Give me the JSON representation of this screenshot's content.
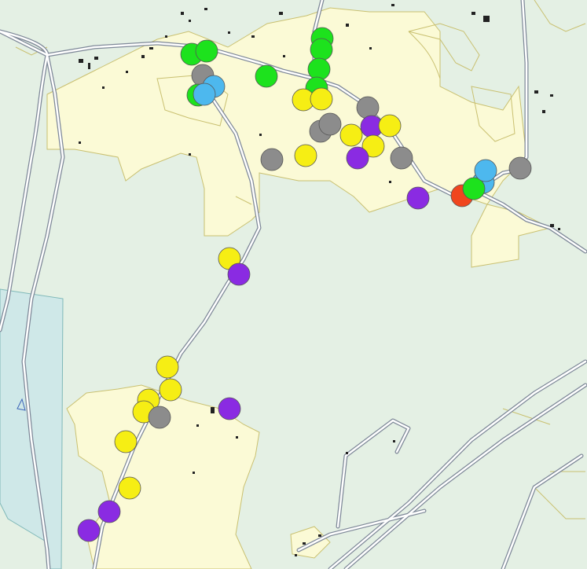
{
  "map": {
    "colors": {
      "background": "#e4f0e4",
      "settlement_fill": "#fbfad6",
      "settlement_stroke": "#c9c070",
      "road": "#b8c0cc",
      "road_edge": "#7e8898",
      "water_fill": "#cfe8e8",
      "water_stroke": "#7fb8b8",
      "building": "#222222"
    },
    "marker_colors": {
      "green": "#1de21d",
      "gray": "#8c8c8c",
      "blue": "#4db8ee",
      "yellow": "#f6ee14",
      "purple": "#8a2be2",
      "red": "#f0461e"
    },
    "icons": [
      "map-marker-circle"
    ]
  }
}
